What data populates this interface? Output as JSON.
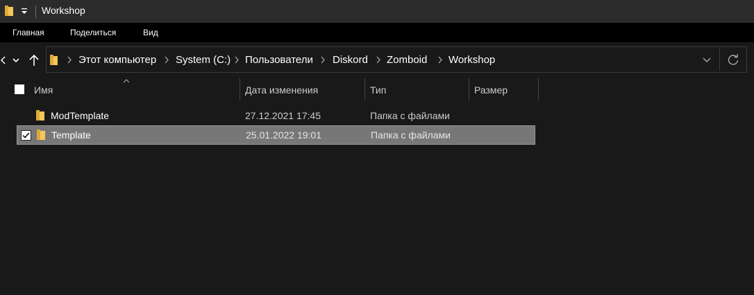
{
  "window": {
    "title": "Workshop"
  },
  "ribbon": {
    "tabs": [
      "Главная",
      "Поделиться",
      "Вид"
    ]
  },
  "address": {
    "breadcrumbs": [
      "Этот компьютер",
      "System (C:)",
      "Пользователи",
      "Diskord",
      "Zomboid",
      "Workshop"
    ]
  },
  "columns": {
    "name": "Имя",
    "date": "Дата изменения",
    "type": "Тип",
    "size": "Размер"
  },
  "files": [
    {
      "name": "ModTemplate",
      "date": "27.12.2021 17:45",
      "type": "Папка с файлами",
      "size": "",
      "selected": false
    },
    {
      "name": "Template",
      "date": "25.01.2022 19:01",
      "type": "Папка с файлами",
      "size": "",
      "selected": true
    }
  ],
  "icons": {
    "folder": "folder-icon",
    "back": "chevron-left-icon",
    "recent": "chevron-down-icon",
    "up": "arrow-up-icon",
    "refresh": "refresh-icon",
    "checkmark": "checkmark-icon"
  },
  "colors": {
    "background": "#191919",
    "titlebar": "#2b2b2b",
    "ribbon": "#000000",
    "selection": "#777777",
    "folder": "#f5c75a"
  }
}
